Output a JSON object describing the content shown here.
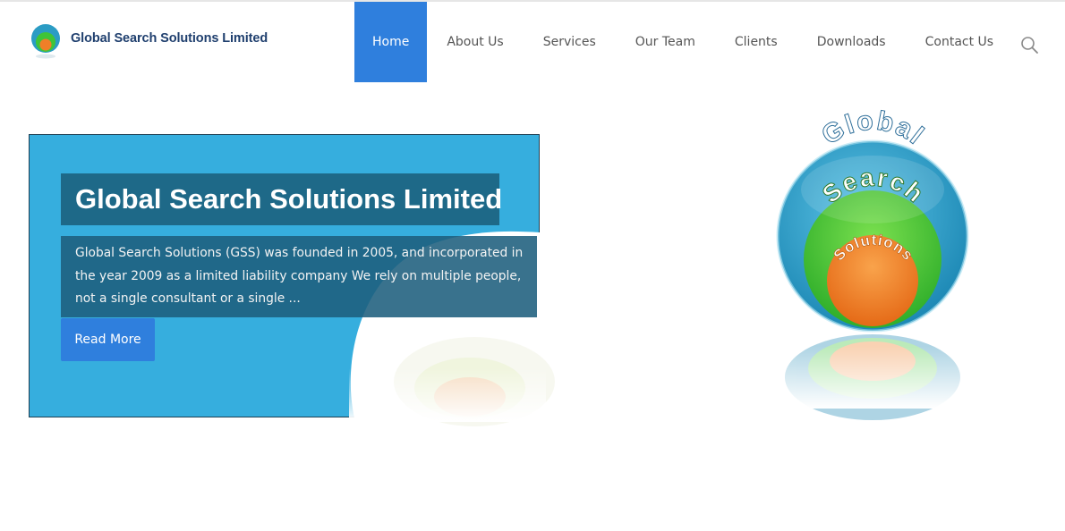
{
  "header": {
    "logo_text": "Global Search Solutions Limited",
    "nav": [
      {
        "label": "Home",
        "active": true
      },
      {
        "label": "About Us"
      },
      {
        "label": "Services"
      },
      {
        "label": "Our Team"
      },
      {
        "label": "Clients"
      },
      {
        "label": "Downloads"
      },
      {
        "label": "Contact Us"
      }
    ],
    "search_icon": "search-icon"
  },
  "hero": {
    "title": "Global Search Solutions Limited",
    "description": "Global Search Solutions (GSS) was founded in 2005, and incorporated in the year 2009 as a limited liability company We rely on multiple people, not a single consultant or a single ...",
    "read_more": "Read More",
    "logo_words": [
      "Global",
      "Search",
      "Solutions"
    ]
  },
  "colors": {
    "accent": "#2f7fdd",
    "panel": "#36aede",
    "title_box": "#1e6988",
    "brand_text": "#1f3f6e",
    "orb_outer": "#2b9cc4",
    "orb_middle": "#3fc438",
    "orb_inner": "#ef7f28"
  }
}
